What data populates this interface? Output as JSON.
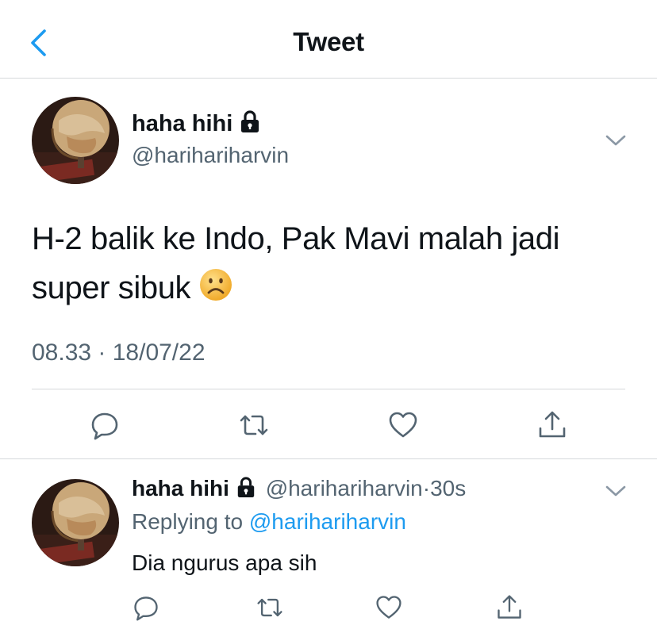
{
  "header": {
    "title": "Tweet",
    "back_icon": "chevron-left-icon"
  },
  "tweet": {
    "display_name": "haha hihi",
    "handle": "@harihariharvin",
    "text": "H-2 balik ke Indo, Pak Mavi malah jadi super sibuk",
    "emoji": "frowning-face-emoji",
    "timestamp": "08.33 · 18/07/22"
  },
  "reply": {
    "display_name": "haha hihi",
    "handle": "@harihariharvin",
    "dot": "·",
    "time": "30s",
    "replying_prefix": "Replying to",
    "replying_to": "@harihariharvin",
    "text": "Dia ngurus apa sih"
  },
  "actions": [
    "comment-icon",
    "retweet-icon",
    "like-icon",
    "share-icon"
  ],
  "colors": {
    "accent": "#1d9bf0",
    "secondary_text": "#536471",
    "divider": "#d6d9db"
  }
}
